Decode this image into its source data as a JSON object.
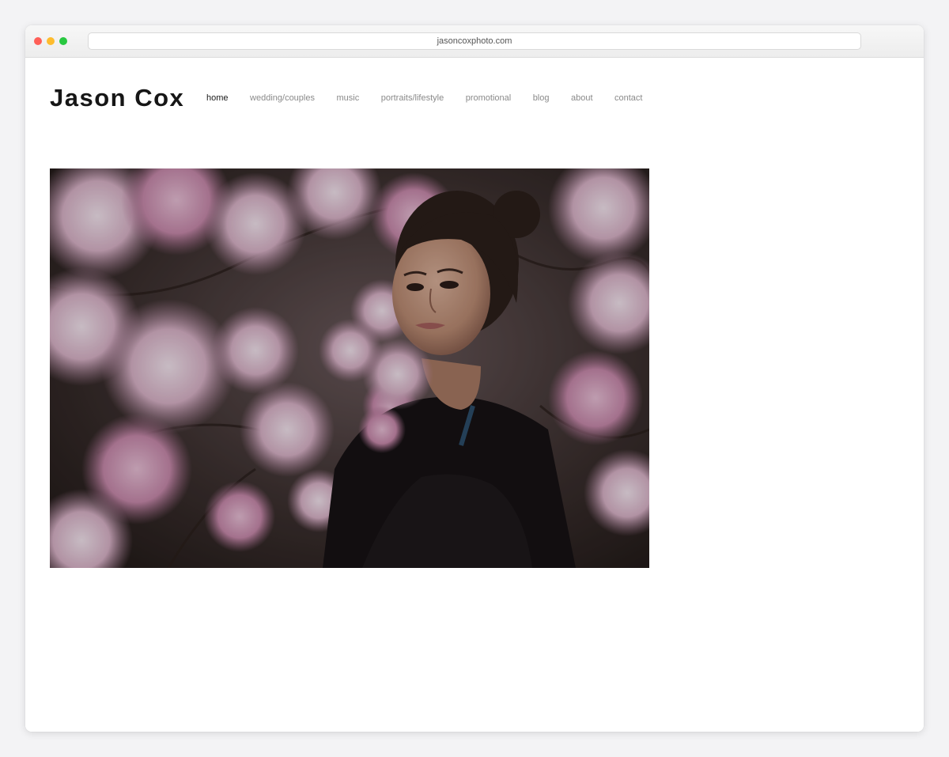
{
  "browser": {
    "url": "jasoncoxphoto.com"
  },
  "site": {
    "logo": "Jason Cox",
    "nav": [
      {
        "label": "home",
        "active": true
      },
      {
        "label": "wedding/couples",
        "active": false
      },
      {
        "label": "music",
        "active": false
      },
      {
        "label": "portraits/lifestyle",
        "active": false
      },
      {
        "label": "promotional",
        "active": false
      },
      {
        "label": "blog",
        "active": false
      },
      {
        "label": "about",
        "active": false
      },
      {
        "label": "contact",
        "active": false
      }
    ]
  },
  "hero": {
    "image_subject": "portrait-photo"
  },
  "colors": {
    "active_nav": "#1a1a1a",
    "inactive_nav": "#8a8a8a",
    "logo": "#161616"
  }
}
